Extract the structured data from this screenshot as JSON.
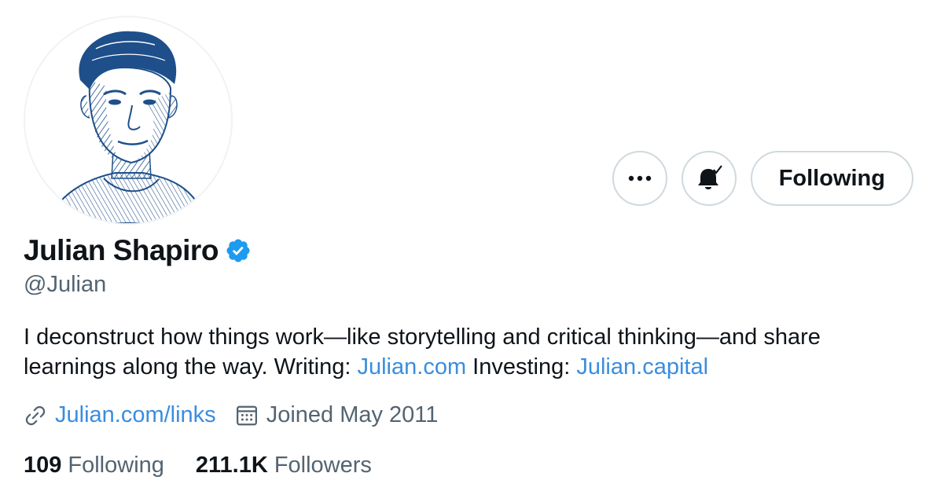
{
  "profile": {
    "name": "Julian Shapiro",
    "handle": "@Julian",
    "verified": true
  },
  "actions": {
    "more_icon": "more-dots-icon",
    "notify_icon": "bell-check-icon",
    "following_label": "Following"
  },
  "bio": {
    "part1": "I deconstruct how things work—like storytelling and critical thinking—and share learnings along the way. Writing: ",
    "link1": "Julian.com",
    "part2": " Investing: ",
    "link2": "Julian.capital"
  },
  "meta": {
    "website": "Julian.com/links",
    "joined": "Joined May 2011"
  },
  "stats": {
    "following_count": "109",
    "following_label": "Following",
    "followers_count": "211.1K",
    "followers_label": "Followers"
  },
  "colors": {
    "text": "#0f1419",
    "secondary": "#536471",
    "link": "#3a8dde",
    "verified": "#1d9bf0",
    "border": "#cfd9de"
  }
}
